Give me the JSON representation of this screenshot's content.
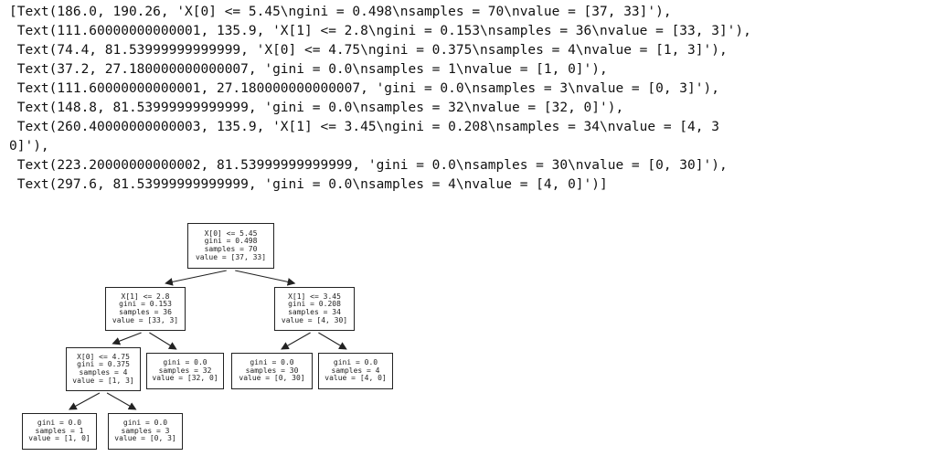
{
  "output_lines": [
    "[Text(186.0, 190.26, 'X[0] <= 5.45\\ngini = 0.498\\nsamples = 70\\nvalue = [37, 33]'),",
    " Text(111.60000000000001, 135.9, 'X[1] <= 2.8\\ngini = 0.153\\nsamples = 36\\nvalue = [33, 3]'),",
    " Text(74.4, 81.53999999999999, 'X[0] <= 4.75\\ngini = 0.375\\nsamples = 4\\nvalue = [1, 3]'),",
    " Text(37.2, 27.180000000000007, 'gini = 0.0\\nsamples = 1\\nvalue = [1, 0]'),",
    " Text(111.60000000000001, 27.180000000000007, 'gini = 0.0\\nsamples = 3\\nvalue = [0, 3]'),",
    " Text(148.8, 81.53999999999999, 'gini = 0.0\\nsamples = 32\\nvalue = [32, 0]'),",
    " Text(260.40000000000003, 135.9, 'X[1] <= 3.45\\ngini = 0.208\\nsamples = 34\\nvalue = [4, 3",
    "0]'),",
    " Text(223.20000000000002, 81.53999999999999, 'gini = 0.0\\nsamples = 30\\nvalue = [0, 30]'),",
    " Text(297.6, 81.53999999999999, 'gini = 0.0\\nsamples = 4\\nvalue = [4, 0]')]"
  ],
  "tree": {
    "nodes": [
      {
        "id": "root",
        "lines": [
          "X[0] <= 5.45",
          "gini = 0.498",
          "samples = 70",
          "value = [37, 33]"
        ]
      },
      {
        "id": "n1",
        "lines": [
          "X[1] <= 2.8",
          "gini = 0.153",
          "samples = 36",
          "value = [33, 3]"
        ]
      },
      {
        "id": "n2",
        "lines": [
          "X[1] <= 3.45",
          "gini = 0.208",
          "samples = 34",
          "value = [4, 30]"
        ]
      },
      {
        "id": "n3",
        "lines": [
          "X[0] <= 4.75",
          "gini = 0.375",
          "samples = 4",
          "value = [1, 3]"
        ]
      },
      {
        "id": "n4",
        "lines": [
          "gini = 0.0",
          "samples = 32",
          "value = [32, 0]"
        ]
      },
      {
        "id": "n5",
        "lines": [
          "gini = 0.0",
          "samples = 30",
          "value = [0, 30]"
        ]
      },
      {
        "id": "n6",
        "lines": [
          "gini = 0.0",
          "samples = 4",
          "value = [4, 0]"
        ]
      },
      {
        "id": "n7",
        "lines": [
          "gini = 0.0",
          "samples = 1",
          "value = [1, 0]"
        ]
      },
      {
        "id": "n8",
        "lines": [
          "gini = 0.0",
          "samples = 3",
          "value = [0, 3]"
        ]
      }
    ],
    "edges": [
      [
        "root",
        "n1"
      ],
      [
        "root",
        "n2"
      ],
      [
        "n1",
        "n3"
      ],
      [
        "n1",
        "n4"
      ],
      [
        "n2",
        "n5"
      ],
      [
        "n2",
        "n6"
      ],
      [
        "n3",
        "n7"
      ],
      [
        "n3",
        "n8"
      ]
    ]
  }
}
